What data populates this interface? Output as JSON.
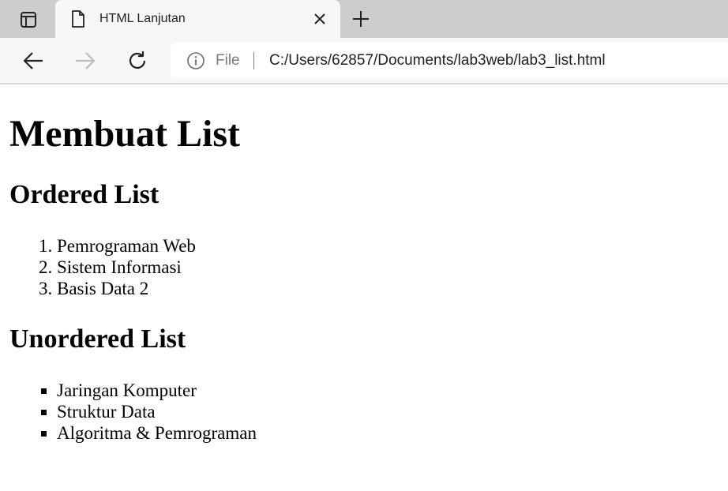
{
  "browser": {
    "tab_title": "HTML Lanjutan",
    "address": {
      "scheme_label": "File",
      "url": "C:/Users/62857/Documents/lab3web/lab3_list.html"
    },
    "icons": {
      "tab_actions": "tab-actions-icon",
      "page": "page-icon",
      "close": "close-icon",
      "new_tab": "plus-icon",
      "back": "back-arrow-icon",
      "forward": "forward-arrow-icon",
      "refresh": "refresh-icon",
      "info": "info-icon"
    },
    "colors": {
      "tabbar_bg": "#cdcdcd",
      "toolbar_bg": "#f7f7f7",
      "forward_disabled": "#bdbdbd"
    }
  },
  "page": {
    "heading": "Membuat List",
    "ordered": {
      "heading": "Ordered List",
      "items": [
        "Pemrograman Web",
        "Sistem Informasi",
        "Basis Data 2"
      ]
    },
    "unordered": {
      "heading": "Unordered List",
      "items": [
        "Jaringan Komputer",
        "Struktur Data",
        "Algoritma & Pemrograman"
      ]
    }
  }
}
